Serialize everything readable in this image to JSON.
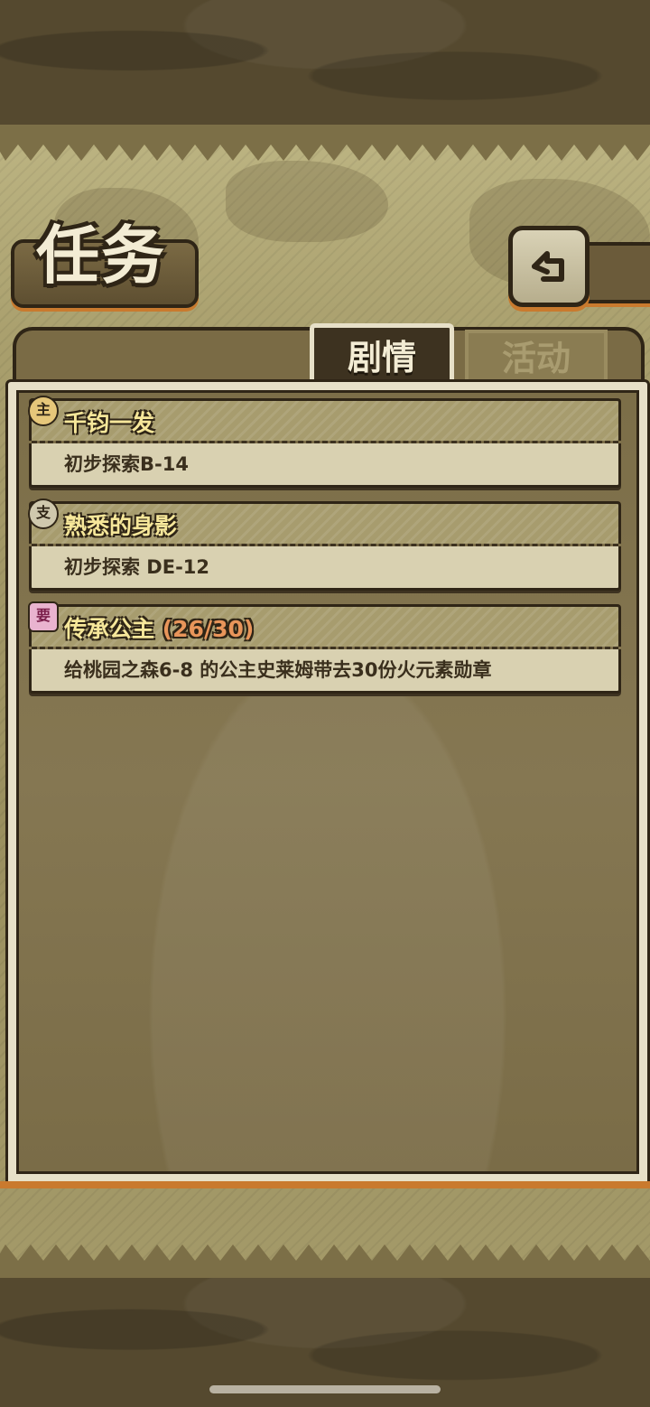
{
  "header": {
    "title": "任务",
    "back_icon": "return-arrow-icon"
  },
  "tabs": [
    {
      "label": "剧情",
      "active": true
    },
    {
      "label": "活动",
      "active": false
    }
  ],
  "quests": [
    {
      "badge": "主",
      "badge_icon": "main-quest-badge-icon",
      "title": "千钧一发",
      "progress": "",
      "description": "初步探索B-14"
    },
    {
      "badge": "支",
      "badge_icon": "side-quest-badge-icon",
      "title": "熟悉的身影",
      "progress": "",
      "description": "初步探索 DE-12"
    },
    {
      "badge": "要",
      "badge_icon": "special-quest-badge-icon",
      "title": "传承公主",
      "progress": "(26/30)",
      "description": "给桃园之森6-8 的公主史莱姆带去30份火元素勋章"
    }
  ],
  "colors": {
    "parchment": "#a89e6c",
    "frame_dark": "#2f2516",
    "accent_orange": "#c97a2e",
    "title_yellow": "#f6e79a",
    "progress_orange": "#e8955a"
  }
}
